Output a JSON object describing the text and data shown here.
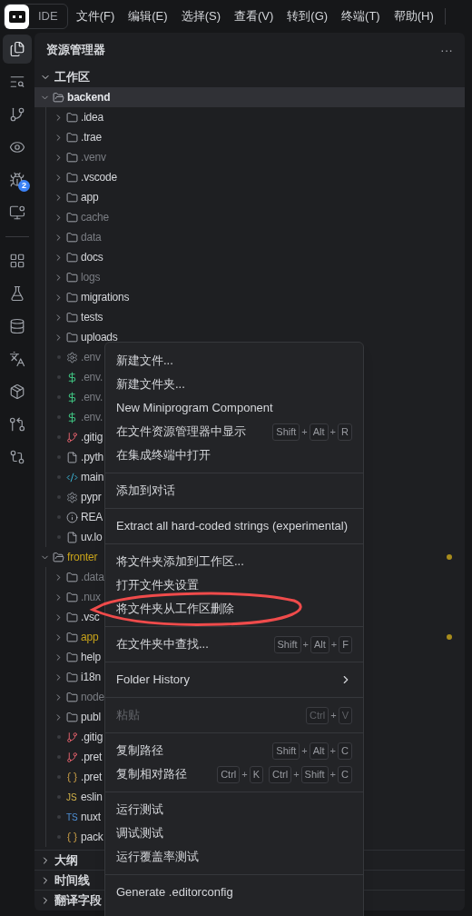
{
  "titlebar": {
    "app_label": "IDE",
    "menus": [
      "文件(F)",
      "编辑(E)",
      "选择(S)",
      "查看(V)",
      "转到(G)",
      "终端(T)",
      "帮助(H)"
    ]
  },
  "activity_bar": {
    "items": [
      {
        "selected": true
      },
      {
        "selected": false
      },
      {
        "selected": false
      },
      {
        "selected": false
      },
      {
        "selected": false,
        "badge": "2"
      },
      {
        "selected": false
      },
      {
        "selected": false
      },
      {
        "selected": false
      },
      {
        "selected": false
      },
      {
        "selected": false
      },
      {
        "selected": false
      },
      {
        "selected": false
      },
      {
        "selected": false
      }
    ]
  },
  "explorer": {
    "title": "资源管理器",
    "more": "···",
    "workspace": {
      "label": "工作区",
      "expanded": true
    },
    "roots": [
      {
        "name": "backend",
        "expanded": true,
        "modified": false,
        "selected": true,
        "children": [
          {
            "name": ".idea",
            "kind": "folder",
            "dimmed": false,
            "modified": false
          },
          {
            "name": ".trae",
            "kind": "folder",
            "dimmed": false,
            "modified": false
          },
          {
            "name": ".venv",
            "kind": "folder",
            "dimmed": true,
            "modified": false
          },
          {
            "name": ".vscode",
            "kind": "folder",
            "dimmed": false,
            "modified": false
          },
          {
            "name": "app",
            "kind": "folder",
            "dimmed": false,
            "modified": false
          },
          {
            "name": "cache",
            "kind": "folder",
            "dimmed": true,
            "modified": false
          },
          {
            "name": "data",
            "kind": "folder",
            "dimmed": true,
            "modified": false
          },
          {
            "name": "docs",
            "kind": "folder",
            "dimmed": false,
            "modified": false
          },
          {
            "name": "logs",
            "kind": "folder",
            "dimmed": true,
            "modified": false
          },
          {
            "name": "migrations",
            "kind": "folder",
            "dimmed": false,
            "modified": false
          },
          {
            "name": "tests",
            "kind": "folder",
            "dimmed": false,
            "modified": false
          },
          {
            "name": "uploads",
            "kind": "folder",
            "dimmed": false,
            "modified": false
          },
          {
            "name": ".env",
            "kind": "settings",
            "dimmed": true,
            "modified": false
          },
          {
            "name": ".env.",
            "kind": "env",
            "dimmed": true,
            "modified": false
          },
          {
            "name": ".env.",
            "kind": "env",
            "dimmed": true,
            "modified": false
          },
          {
            "name": ".env.",
            "kind": "env",
            "dimmed": true,
            "modified": false
          },
          {
            "name": ".gitig",
            "kind": "git",
            "dimmed": false,
            "modified": false
          },
          {
            "name": ".pyth",
            "kind": "file",
            "dimmed": false,
            "modified": false
          },
          {
            "name": "main",
            "kind": "python",
            "dimmed": false,
            "modified": false
          },
          {
            "name": "pypr",
            "kind": "settings",
            "dimmed": false,
            "modified": false
          },
          {
            "name": "REA",
            "kind": "info",
            "dimmed": false,
            "modified": false
          },
          {
            "name": "uv.lo",
            "kind": "file",
            "dimmed": false,
            "modified": false
          }
        ]
      },
      {
        "name": "fronter",
        "expanded": true,
        "modified": true,
        "selected": false,
        "children": [
          {
            "name": ".data",
            "kind": "folder",
            "dimmed": true,
            "modified": false
          },
          {
            "name": ".nux",
            "kind": "folder",
            "dimmed": true,
            "modified": false
          },
          {
            "name": ".vsc",
            "kind": "folder",
            "dimmed": false,
            "modified": false
          },
          {
            "name": "app",
            "kind": "folder",
            "dimmed": false,
            "modified": true
          },
          {
            "name": "help",
            "kind": "folder",
            "dimmed": false,
            "modified": false
          },
          {
            "name": "i18n",
            "kind": "folder",
            "dimmed": false,
            "modified": false
          },
          {
            "name": "node",
            "kind": "folder",
            "dimmed": true,
            "modified": false
          },
          {
            "name": "publ",
            "kind": "folder",
            "dimmed": false,
            "modified": false
          },
          {
            "name": ".gitig",
            "kind": "git",
            "dimmed": false,
            "modified": false
          },
          {
            "name": ".pret",
            "kind": "git",
            "dimmed": false,
            "modified": false
          },
          {
            "name": ".pret",
            "kind": "json",
            "dimmed": false,
            "modified": false
          },
          {
            "name": "eslin",
            "kind": "script",
            "badge": "JS",
            "dimmed": false,
            "modified": false
          },
          {
            "name": "nuxt",
            "kind": "script",
            "badge": "TS",
            "dimmed": false,
            "modified": false
          },
          {
            "name": "pack",
            "kind": "json",
            "dimmed": false,
            "modified": false
          }
        ]
      }
    ],
    "sections": [
      {
        "label": "大纲",
        "expanded": false
      },
      {
        "label": "时间线",
        "expanded": false
      },
      {
        "label": "翻译字段",
        "expanded": false
      }
    ]
  },
  "context_menu": {
    "groups": [
      [
        {
          "label": "新建文件...",
          "disabled": false,
          "has_submenu": false
        },
        {
          "label": "新建文件夹...",
          "disabled": false,
          "has_submenu": false
        },
        {
          "label": "New Miniprogram Component",
          "disabled": false,
          "has_submenu": false
        },
        {
          "label": "在文件资源管理器中显示",
          "disabled": false,
          "has_submenu": false,
          "shortcut": [
            [
              "Shift",
              "+",
              "Alt",
              "+",
              "R"
            ]
          ]
        },
        {
          "label": "在集成终端中打开",
          "disabled": false,
          "has_submenu": false
        }
      ],
      [
        {
          "label": "添加到对话",
          "disabled": false,
          "has_submenu": false
        }
      ],
      [
        {
          "label": "Extract all hard-coded strings (experimental)",
          "disabled": false,
          "has_submenu": false
        }
      ],
      [
        {
          "label": "将文件夹添加到工作区...",
          "disabled": false,
          "has_submenu": false
        },
        {
          "label": "打开文件夹设置",
          "disabled": false,
          "has_submenu": false
        },
        {
          "label": "将文件夹从工作区删除",
          "disabled": false,
          "has_submenu": false,
          "annotated": true
        }
      ],
      [
        {
          "label": "在文件夹中查找...",
          "disabled": false,
          "has_submenu": false,
          "shortcut": [
            [
              "Shift",
              "+",
              "Alt",
              "+",
              "F"
            ]
          ]
        }
      ],
      [
        {
          "label": "Folder History",
          "disabled": false,
          "has_submenu": true
        }
      ],
      [
        {
          "label": "粘贴",
          "disabled": true,
          "has_submenu": false,
          "shortcut": [
            [
              "Ctrl",
              "+",
              "V"
            ]
          ]
        }
      ],
      [
        {
          "label": "复制路径",
          "disabled": false,
          "has_submenu": false,
          "shortcut": [
            [
              "Shift",
              "+",
              "Alt",
              "+",
              "C"
            ]
          ]
        },
        {
          "label": "复制相对路径",
          "disabled": false,
          "has_submenu": false,
          "shortcut": [
            [
              "Ctrl",
              "+",
              "K"
            ],
            [
              "Ctrl",
              "+",
              "Shift",
              "+",
              "C"
            ]
          ]
        }
      ],
      [
        {
          "label": "运行测试",
          "disabled": false,
          "has_submenu": false
        },
        {
          "label": "调试测试",
          "disabled": false,
          "has_submenu": false
        },
        {
          "label": "运行覆盖率测试",
          "disabled": false,
          "has_submenu": false
        }
      ],
      [
        {
          "label": "Generate .editorconfig",
          "disabled": false,
          "has_submenu": false
        }
      ]
    ]
  }
}
